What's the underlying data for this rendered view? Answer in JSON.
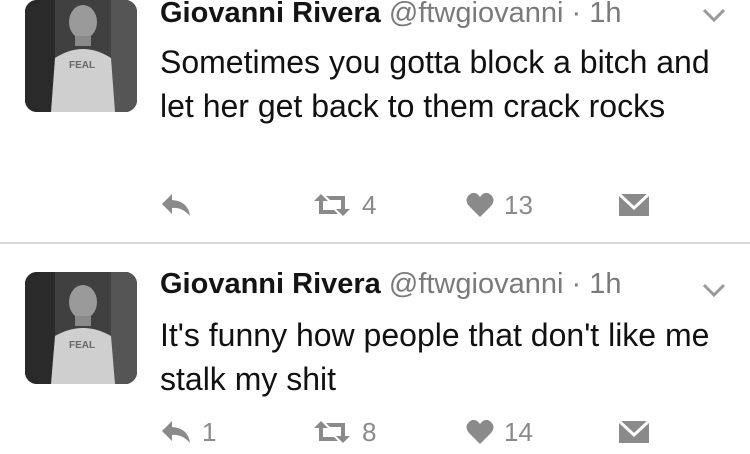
{
  "tweets": [
    {
      "name": "Giovanni Rivera",
      "handle": "@ftwgiovanni",
      "dot": "·",
      "time": "1h",
      "text": "Sometimes you gotta block a bitch and let her get back to them crack rocks",
      "replies": "",
      "retweets": "4",
      "likes": "13"
    },
    {
      "name": "Giovanni Rivera",
      "handle": "@ftwgiovanni",
      "dot": "·",
      "time": "1h",
      "text": "It's funny how people that don't like me stalk my shit",
      "replies": "1",
      "retweets": "8",
      "likes": "14"
    }
  ],
  "colors": {
    "background": "#ffffff",
    "text": "#111111",
    "muted": "#7a7a7a",
    "icon": "#8a8a8a",
    "divider": "#d8d8d8"
  },
  "icons": [
    "reply-icon",
    "retweet-icon",
    "heart-icon",
    "direct-message-icon",
    "chevron-down-icon"
  ]
}
